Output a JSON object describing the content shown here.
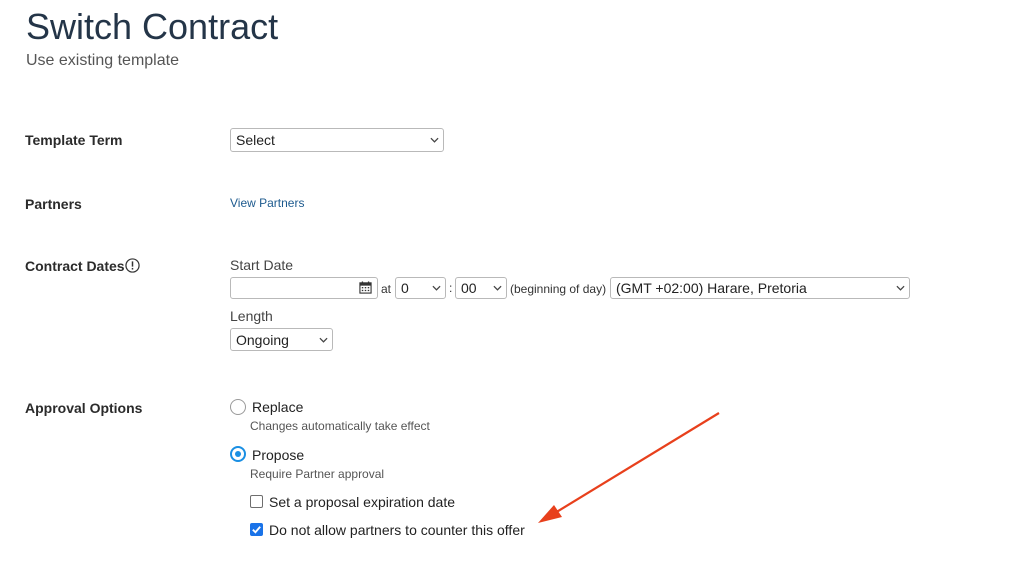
{
  "header": {
    "title": "Switch Contract",
    "subtitle": "Use existing template"
  },
  "template_term": {
    "label": "Template Term",
    "selected": "Select"
  },
  "partners": {
    "label": "Partners",
    "link": "View Partners"
  },
  "contract_dates": {
    "label": "Contract Dates",
    "info_icon": "exclamation-circle-icon",
    "start_date_label": "Start Date",
    "start_date_value": "",
    "at_label": "at",
    "hour": "0",
    "colon": ":",
    "minute": "00",
    "day_hint": "(beginning of day)",
    "timezone": "(GMT +02:00) Harare, Pretoria",
    "length_label": "Length",
    "length_value": "Ongoing"
  },
  "approval_options": {
    "label": "Approval Options",
    "options": [
      {
        "label": "Replace",
        "description": "Changes automatically take effect",
        "selected": false
      },
      {
        "label": "Propose",
        "description": "Require Partner approval",
        "selected": true
      }
    ],
    "checkboxes": [
      {
        "label": "Set a proposal expiration date",
        "checked": false
      },
      {
        "label": "Do not allow partners to counter this offer",
        "checked": true
      }
    ]
  },
  "annotation": {
    "arrow_color": "#e8401c"
  },
  "colors": {
    "accent": "#1a8fe3",
    "title": "#243548",
    "link": "#1d5a8e"
  }
}
